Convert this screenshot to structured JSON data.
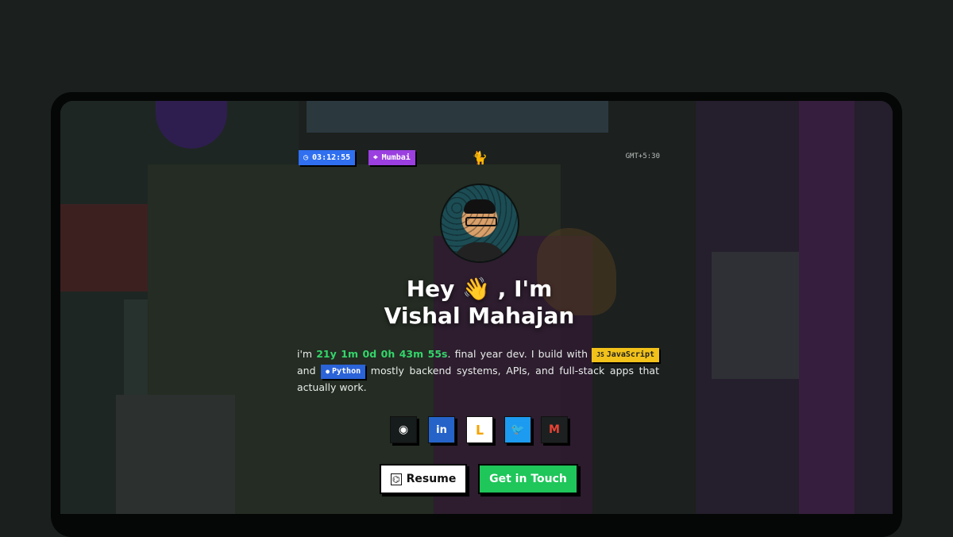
{
  "header": {
    "clock": "03:12:55",
    "clock_icon": "clock-icon",
    "city": "Mumbai",
    "city_icon": "map-pin-icon",
    "mascot_icon": "cat-mascot-icon",
    "timezone": "GMT+5:30"
  },
  "hero": {
    "greeting_prefix": "Hey ",
    "wave_emoji": "👋",
    "greeting_suffix": " , I'm",
    "name": "Vishal Mahajan"
  },
  "bio": {
    "prefix": "i'm ",
    "age": "21y 1m 0d 0h 43m 55s",
    "middle": ". final year dev. I build with ",
    "lang1": "JavaScript",
    "lang1_badge": "JS",
    "and": " and",
    "lang2": "Python",
    "rest": " mostly backend systems, APIs, and full-stack apps that actually work."
  },
  "socials": [
    {
      "name": "GitHub",
      "icon": "github-icon",
      "glyph": "◉"
    },
    {
      "name": "LinkedIn",
      "icon": "linkedin-icon",
      "glyph": "in"
    },
    {
      "name": "LeetCode",
      "icon": "leetcode-icon",
      "glyph": "ᒪ"
    },
    {
      "name": "Twitter",
      "icon": "twitter-icon",
      "glyph": "🐦"
    },
    {
      "name": "Gmail",
      "icon": "gmail-icon",
      "glyph": "M"
    }
  ],
  "buttons": {
    "resume": "Resume",
    "contact": "Get in Touch"
  },
  "colors": {
    "page_bg": "#1b201f",
    "accent_blue": "#2f6ff0",
    "accent_purple": "#9b3fe0",
    "accent_green": "#1fc65a",
    "js_yellow": "#f2c21a"
  }
}
